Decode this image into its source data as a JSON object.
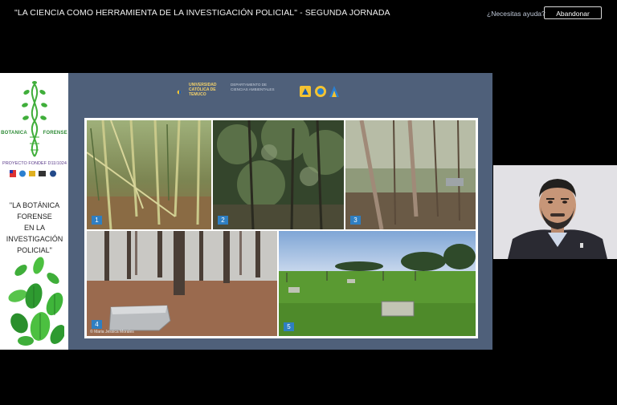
{
  "meeting": {
    "title": "\"LA CIENCIA COMO HERRAMIENTA DE LA INVESTIGACIÓN POLICIAL\" - SEGUNDA JORNADA",
    "help_link": "¿Necesitas ayuda?",
    "leave_button": "Abandonar"
  },
  "poster": {
    "brand_left": "BOTANICA",
    "brand_right": "FORENSE",
    "project": "PROYECTO FONDEF D11I1024",
    "quote_lines": [
      "\"LA BOTÁNICA FORENSE",
      "EN LA INVESTIGACIÓN",
      "POLICIAL\""
    ]
  },
  "slide": {
    "university_lines": [
      "UNIVERSIDAD",
      "CATÓLICA DE",
      "TEMUCO"
    ],
    "department_lines": [
      "DEPARTAMENTO DE",
      "CIENCIAS AMBIENTALES"
    ],
    "photo_numbers": [
      "1",
      "2",
      "3",
      "4",
      "5"
    ],
    "credit": "© Maria Jessica Morales"
  },
  "colors": {
    "background": "#000000",
    "slide_bg": "#4f607a",
    "number_badge": "#2f7fc2",
    "leaf_green": "#3fae3a"
  }
}
